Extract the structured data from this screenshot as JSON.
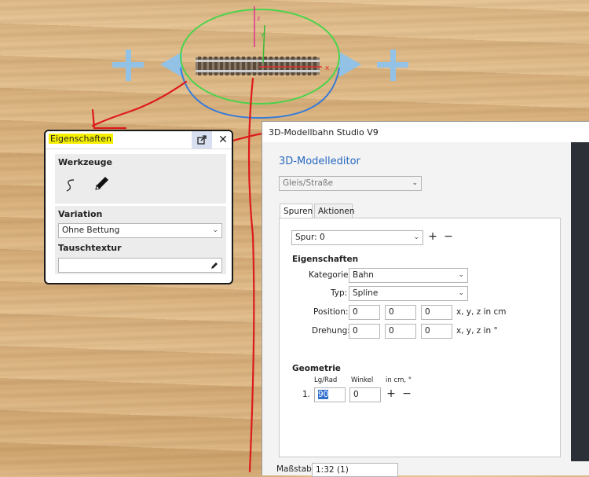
{
  "props_panel": {
    "title": "Eigenschaften",
    "werkzeuge_label": "Werkzeuge",
    "variation_label": "Variation",
    "variation_value": "Ohne Bettung",
    "tauschtextur_label": "Tauschtextur",
    "tauschtextur_value": ""
  },
  "editor": {
    "window_title": "3D-Modellbahn Studio V9",
    "heading": "3D-Modelleditor",
    "category_combo": "Gleis/Straße",
    "tabs": [
      "Spuren",
      "Aktionen"
    ],
    "spur_combo": "Spur: 0",
    "eigenschaften_label": "Eigenschaften",
    "kategorie_label": "Kategorie:",
    "kategorie_value": "Bahn",
    "typ_label": "Typ:",
    "typ_value": "Spline",
    "position_label": "Position:",
    "position_values": [
      "0",
      "0",
      "0"
    ],
    "position_unit": "x, y, z in cm",
    "drehung_label": "Drehung:",
    "drehung_values": [
      "0",
      "0",
      "0"
    ],
    "drehung_unit": "x, y, z in °",
    "geometrie_label": "Geometrie",
    "col_lgrad": "Lg/Rad",
    "col_winkel": "Winkel",
    "col_units": "in cm, °",
    "row_index": "1.",
    "lgrad_value": "90",
    "winkel_value": "0",
    "bottom_label": "Maßstab",
    "bottom_value": "1:32 (1)"
  },
  "scene": {
    "axis_x": "x",
    "axis_y": "y",
    "axis_z": "z"
  },
  "icons": [
    "detach-icon",
    "close-icon",
    "spline-tool-icon",
    "pencil-icon",
    "chevron-down-icon",
    "plus-icon",
    "minus-icon"
  ],
  "colors": {
    "highlight": "#f6f000",
    "link_blue": "#2868c0",
    "annotation_red": "#dd1a1a",
    "accent_blue": "#3a7bd5"
  }
}
